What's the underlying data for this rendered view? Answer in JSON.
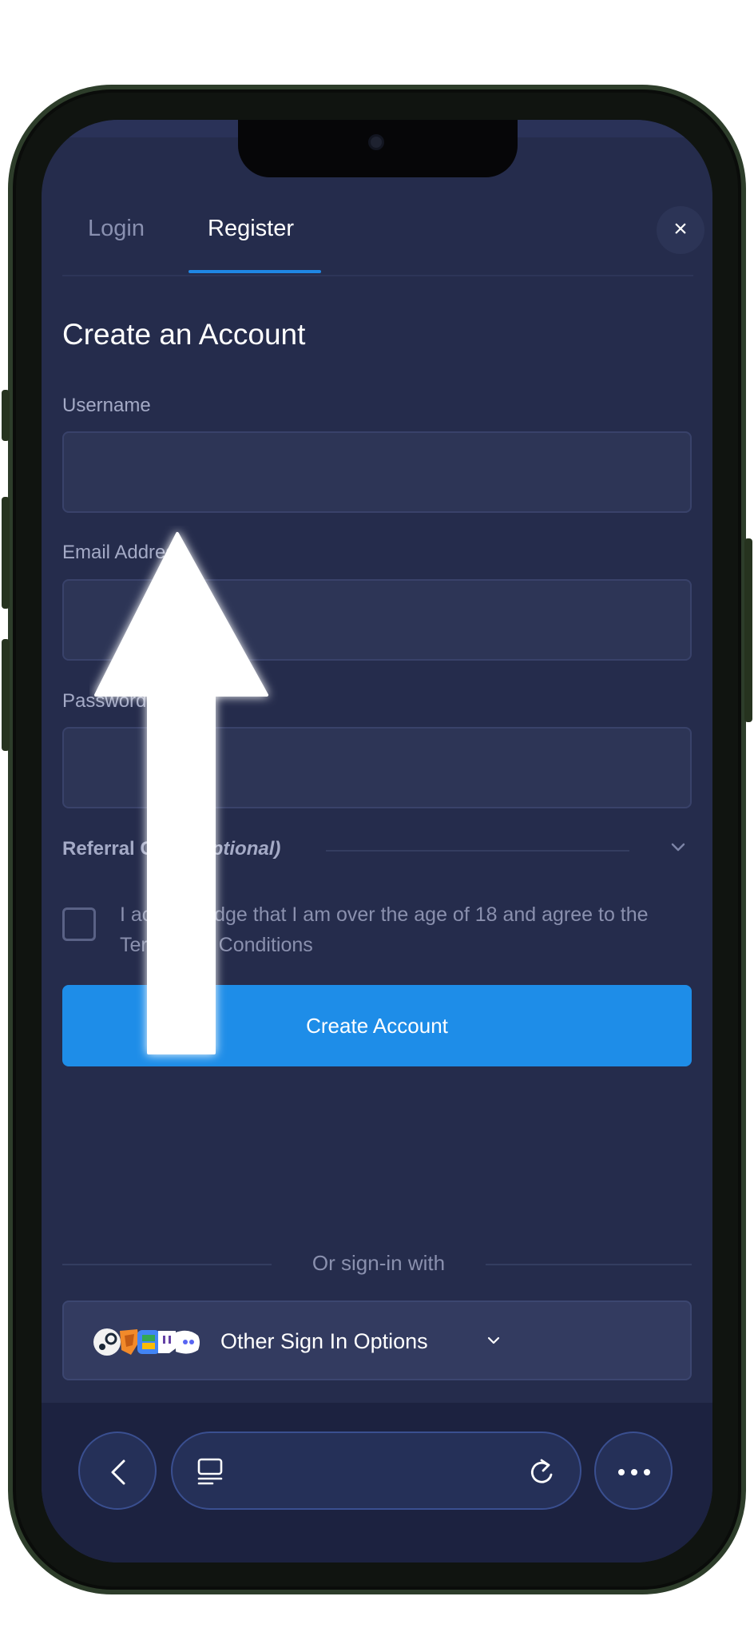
{
  "tabs": {
    "login": "Login",
    "register": "Register",
    "active": "Register"
  },
  "close": {
    "label": "×"
  },
  "form": {
    "title": "Create an Account",
    "username_label": "Username",
    "username_value": "",
    "email_label": "Email Address",
    "email_value": "",
    "password_label": "Password",
    "password_value": "",
    "referral_label": "Referral Code ",
    "referral_optional": "(optional)",
    "terms_text": "I acknowledge that I am over the age of 18 and agree to the Terms and Conditions",
    "terms_checked": false,
    "submit_label": "Create Account"
  },
  "signin": {
    "divider_text": "Or sign-in with",
    "other_label": "Other Sign In Options",
    "provider_icons": [
      "steam-icon",
      "metamask-icon",
      "google-icon",
      "twitch-icon",
      "discord-icon"
    ]
  },
  "browser": {
    "back_icon": "chevron-left-icon",
    "tabs_icon": "tabs-icon",
    "reload_icon": "reload-icon",
    "more_icon": "more-icon"
  },
  "overlay": {
    "icon": "up-arrow-icon"
  },
  "colors": {
    "background": "#252c4c",
    "accent": "#1e8de8",
    "input_bg": "#2d3556",
    "bottom_bar": "#1c2240"
  }
}
